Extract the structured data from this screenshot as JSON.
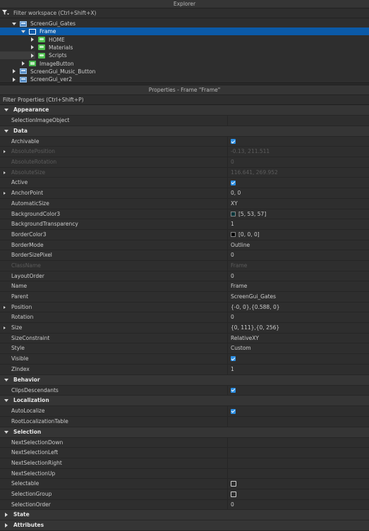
{
  "explorer": {
    "title": "Explorer",
    "filter_placeholder": "Filter workspace (Ctrl+Shift+X)",
    "tree": [
      {
        "label": "ScreenGui_Gates",
        "icon": "screengui-icon",
        "expand": "down",
        "indent": 0
      },
      {
        "label": "Frame",
        "icon": "frame-icon",
        "expand": "down",
        "indent": 1,
        "selected": true
      },
      {
        "label": "HOME",
        "icon": "folder-icon",
        "expand": "right",
        "indent": 2
      },
      {
        "label": "Materials",
        "icon": "folder-icon",
        "expand": "right",
        "indent": 2
      },
      {
        "label": "Scripts",
        "icon": "folder-icon",
        "expand": "right",
        "indent": 2
      },
      {
        "label": "ImageButton",
        "icon": "imagebutton-icon",
        "expand": "right",
        "indent": 1
      },
      {
        "label": "ScreenGui_Music_Button",
        "icon": "screengui-icon",
        "expand": "right",
        "indent": 0
      },
      {
        "label": "ScreenGui_ver2",
        "icon": "screengui-icon",
        "expand": "right",
        "indent": 0
      }
    ]
  },
  "properties": {
    "title": "Properties - Frame \"Frame\"",
    "filter_placeholder": "Filter Properties (Ctrl+Shift+P)",
    "sections": [
      {
        "name": "Appearance",
        "open": true,
        "props": [
          {
            "name": "SelectionImageObject",
            "value": ""
          }
        ]
      },
      {
        "name": "Data",
        "open": true,
        "props": [
          {
            "name": "Archivable",
            "type": "check",
            "checked": true
          },
          {
            "name": "AbsolutePosition",
            "value": "-0.13, 211.511",
            "dim": true,
            "expandable": true
          },
          {
            "name": "AbsoluteRotation",
            "value": "0",
            "dim": true
          },
          {
            "name": "AbsoluteSize",
            "value": "116.641, 269.952",
            "dim": true,
            "expandable": true
          },
          {
            "name": "Active",
            "type": "check",
            "checked": true
          },
          {
            "name": "AnchorPoint",
            "value": "0, 0",
            "expandable": true
          },
          {
            "name": "AutomaticSize",
            "value": "XY"
          },
          {
            "name": "BackgroundColor3",
            "value": "[5, 53, 57]",
            "swatch": "#053539"
          },
          {
            "name": "BackgroundTransparency",
            "value": "1"
          },
          {
            "name": "BorderColor3",
            "value": "[0, 0, 0]",
            "swatch": "#000000"
          },
          {
            "name": "BorderMode",
            "value": "Outline"
          },
          {
            "name": "BorderSizePixel",
            "value": "0"
          },
          {
            "name": "ClassName",
            "value": "Frame",
            "dim": true
          },
          {
            "name": "LayoutOrder",
            "value": "0"
          },
          {
            "name": "Name",
            "value": "Frame"
          },
          {
            "name": "Parent",
            "value": "ScreenGui_Gates"
          },
          {
            "name": "Position",
            "value": "{-0, 0},{0.588, 0}",
            "expandable": true
          },
          {
            "name": "Rotation",
            "value": "0"
          },
          {
            "name": "Size",
            "value": "{0, 111},{0, 256}",
            "expandable": true
          },
          {
            "name": "SizeConstraint",
            "value": "RelativeXY"
          },
          {
            "name": "Style",
            "value": "Custom"
          },
          {
            "name": "Visible",
            "type": "check",
            "checked": true
          },
          {
            "name": "ZIndex",
            "value": "1"
          }
        ]
      },
      {
        "name": "Behavior",
        "open": true,
        "props": [
          {
            "name": "ClipsDescendants",
            "type": "check",
            "checked": true
          }
        ]
      },
      {
        "name": "Localization",
        "open": true,
        "props": [
          {
            "name": "AutoLocalize",
            "type": "check",
            "checked": true
          },
          {
            "name": "RootLocalizationTable",
            "value": ""
          }
        ]
      },
      {
        "name": "Selection",
        "open": true,
        "props": [
          {
            "name": "NextSelectionDown",
            "value": ""
          },
          {
            "name": "NextSelectionLeft",
            "value": ""
          },
          {
            "name": "NextSelectionRight",
            "value": ""
          },
          {
            "name": "NextSelectionUp",
            "value": ""
          },
          {
            "name": "Selectable",
            "type": "check",
            "checked": false
          },
          {
            "name": "SelectionGroup",
            "type": "check",
            "checked": false
          },
          {
            "name": "SelectionOrder",
            "value": "0"
          }
        ]
      },
      {
        "name": "State",
        "open": false,
        "props": []
      },
      {
        "name": "Attributes",
        "open": false,
        "props": []
      }
    ]
  }
}
